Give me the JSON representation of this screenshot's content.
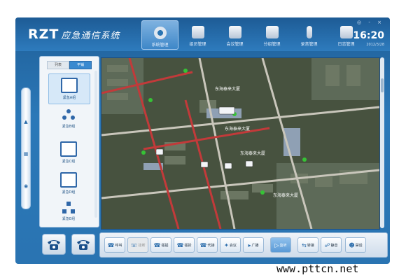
{
  "app": {
    "brand": "RZT",
    "title_cn": "应急通信系统",
    "window_controls": "◎ - ×"
  },
  "nav": [
    {
      "label": "系统管理",
      "icon": "gear-icon",
      "active": true
    },
    {
      "label": "组员管理",
      "icon": "members-icon",
      "active": false
    },
    {
      "label": "会议管理",
      "icon": "meeting-icon",
      "active": false
    },
    {
      "label": "分组管理",
      "icon": "group-manage-icon",
      "active": false
    },
    {
      "label": "录音管理",
      "icon": "microphone-icon",
      "active": false
    },
    {
      "label": "日志管理",
      "icon": "log-icon",
      "active": false
    }
  ],
  "clock": {
    "time": "16:20",
    "date": "2012/3/28"
  },
  "panel": {
    "tabs": [
      {
        "label": "列表",
        "active": false
      },
      {
        "label": "平铺",
        "active": true
      }
    ],
    "groups": [
      {
        "label": "紧急A组",
        "selected": true
      },
      {
        "label": "紧急B组",
        "selected": false
      },
      {
        "label": "紧急C组",
        "selected": false
      },
      {
        "label": "紧急D组",
        "selected": false
      },
      {
        "label": "紧急E组",
        "selected": false
      }
    ]
  },
  "map": {
    "labels": [
      "东海泰来大厦",
      "东海泰来大厦",
      "东海泰来大厦",
      "东海泰来大厦"
    ]
  },
  "toolbar": [
    {
      "label": "呼叫",
      "icon": "handset-icon",
      "state": "normal"
    },
    {
      "label": "挂断",
      "icon": "hangup-icon",
      "state": "disabled"
    },
    {
      "label": "强插",
      "icon": "barge-in-icon",
      "state": "normal"
    },
    {
      "label": "强拆",
      "icon": "force-release-icon",
      "state": "normal"
    },
    {
      "label": "代接",
      "icon": "pickup-icon",
      "state": "normal"
    },
    {
      "label": "会议",
      "icon": "conference-icon",
      "state": "normal"
    },
    {
      "label": "广播",
      "icon": "broadcast-icon",
      "state": "normal"
    },
    {
      "label": "监听",
      "icon": "monitor-icon",
      "state": "active"
    },
    {
      "label": "转接",
      "icon": "transfer-icon",
      "state": "normal"
    },
    {
      "label": "静音",
      "icon": "mute-icon",
      "state": "normal"
    },
    {
      "label": "禁话",
      "icon": "block-icon",
      "state": "normal"
    }
  ],
  "watermark": "www.pttcn.net"
}
